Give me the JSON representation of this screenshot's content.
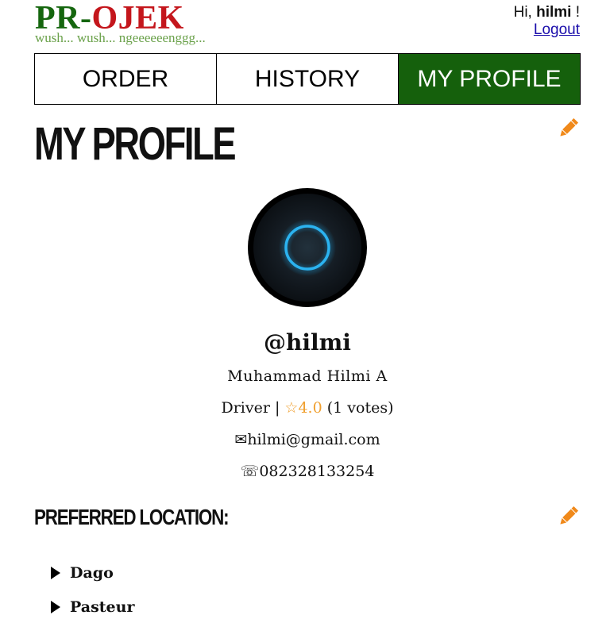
{
  "header": {
    "logo_part1": "PR-",
    "logo_part2": "OJEK",
    "tagline": "wush... wush... ngeeeeeenggg...",
    "greeting_prefix": "Hi, ",
    "greeting_user": "hilmi",
    "greeting_suffix": " !",
    "logout_label": "Logout"
  },
  "tabs": [
    {
      "label": "ORDER",
      "active": false
    },
    {
      "label": "HISTORY",
      "active": false
    },
    {
      "label": "MY PROFILE",
      "active": true
    }
  ],
  "page": {
    "title": "MY PROFILE",
    "edit_icon": "pencil-icon"
  },
  "profile": {
    "username": "@hilmi",
    "full_name": "Muhammad Hilmi A",
    "role": "Driver",
    "separator": " | ",
    "star_glyph": "☆",
    "rating": "4.0",
    "votes": "(1 votes)",
    "email_icon": "✉",
    "email": "hilmi@gmail.com",
    "phone_icon": "☏",
    "phone": "082328133254"
  },
  "preferred": {
    "title": "PREFERRED LOCATION:",
    "locations": [
      "Dago",
      "Pasteur"
    ]
  },
  "colors": {
    "brand_green": "#15600c",
    "brand_red": "#c4161c",
    "tagline_green": "#6aa14a",
    "accent_orange": "#f0891a",
    "rating_orange": "#f0a030"
  }
}
